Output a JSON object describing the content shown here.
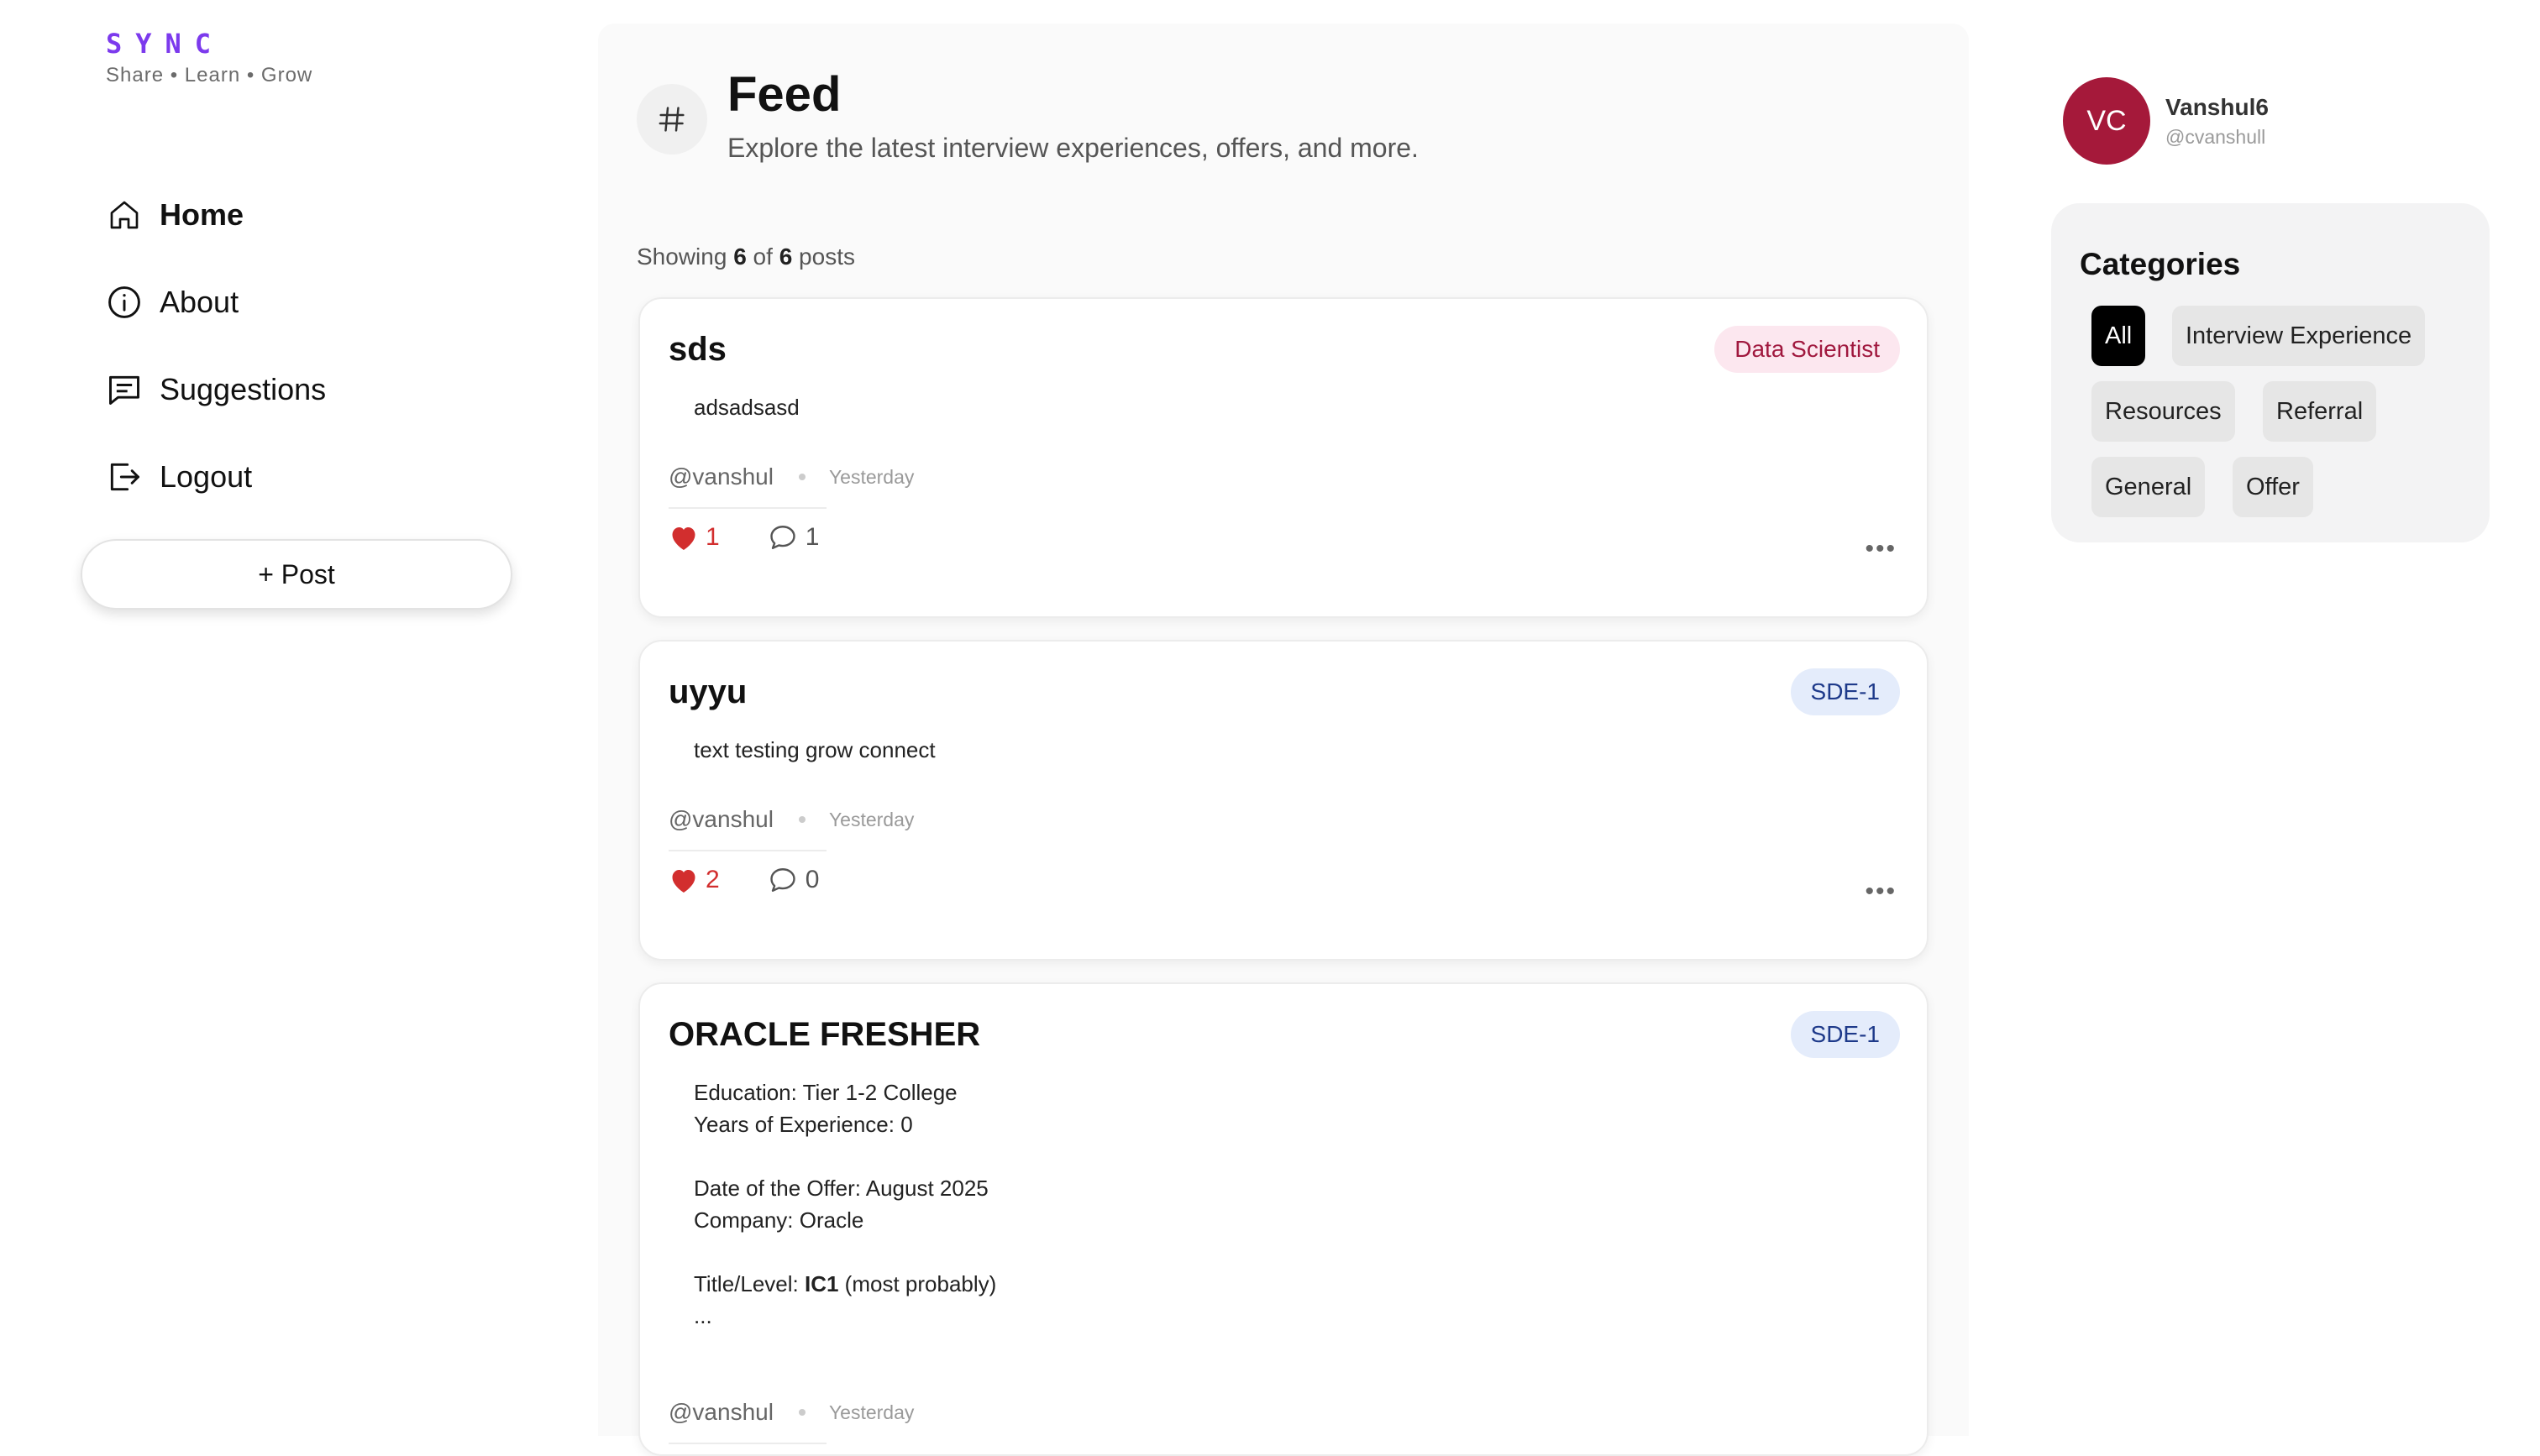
{
  "brand": {
    "logo": "SYNC",
    "tagline": "Share • Learn • Grow"
  },
  "nav": {
    "items": [
      {
        "label": "Home",
        "icon": "home-icon",
        "active": true
      },
      {
        "label": "About",
        "icon": "info-icon",
        "active": false
      },
      {
        "label": "Suggestions",
        "icon": "message-square-icon",
        "active": false
      },
      {
        "label": "Logout",
        "icon": "logout-icon",
        "active": false
      }
    ],
    "post_button": "+ Post"
  },
  "feed": {
    "icon": "hash-icon",
    "title": "Feed",
    "subtitle": "Explore the latest interview experiences, offers, and more.",
    "showing": {
      "prefix": "Showing",
      "shown": "6",
      "of": "of",
      "total": "6",
      "suffix": "posts"
    },
    "posts": [
      {
        "title": "sds",
        "tag": "Data Scientist",
        "body": [
          "adsadsasd"
        ],
        "author": "@vanshul",
        "time": "Yesterday",
        "likes": "1",
        "comments": "1"
      },
      {
        "title": "uyyu",
        "tag": "SDE-1",
        "body": [
          "text testing grow connect"
        ],
        "author": "@vanshul",
        "time": "Yesterday",
        "likes": "2",
        "comments": "0"
      },
      {
        "title": "ORACLE FRESHER",
        "tag": "SDE-1",
        "body_lines": {
          "education": "Education: Tier 1-2 College",
          "experience": "Years of Experience: 0",
          "date": "Date of the Offer: August 2025",
          "company": "Company: Oracle",
          "title_label": "Title/Level: ",
          "title_value": "IC1",
          "title_note": " (most probably)",
          "ellipsis": "..."
        },
        "author": "@vanshul",
        "time": "Yesterday"
      }
    ],
    "more_icon": "more-horizontal-icon"
  },
  "profile": {
    "initials": "VC",
    "name": "Vanshul6",
    "handle": "@cvanshull",
    "avatar_color": "#a5193a"
  },
  "categories": {
    "title": "Categories",
    "items": [
      "All",
      "Interview Experience",
      "Resources",
      "Referral",
      "General",
      "Offer"
    ],
    "selected": "All"
  },
  "colors": {
    "brand": "#7c3aed",
    "like": "#d22e2e",
    "tag_pink_bg": "#fce7ef",
    "tag_pink_text": "#a0183e",
    "tag_blue_bg": "#e4ecfb",
    "tag_blue_text": "#1e3a8a"
  }
}
